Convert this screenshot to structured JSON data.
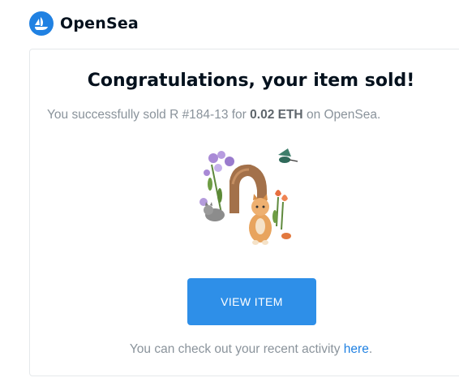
{
  "brand": {
    "name": "OpenSea",
    "color": "#2081e2"
  },
  "email": {
    "title": "Congratulations, your item sold!",
    "subtitle": {
      "prefix": "You successfully sold R #184-13 for ",
      "amount": "0.02 ETH",
      "suffix": " on OpenSea."
    },
    "item_image": {
      "icon": "nft-artwork-cat-flowers"
    },
    "button_label": "VIEW ITEM",
    "footer": {
      "text": "You can check out your recent activity ",
      "link_label": "here",
      "end": "."
    }
  },
  "colors": {
    "accent": "#2e8fe8",
    "text_muted": "#8a939b",
    "text_dark": "#04111d"
  }
}
